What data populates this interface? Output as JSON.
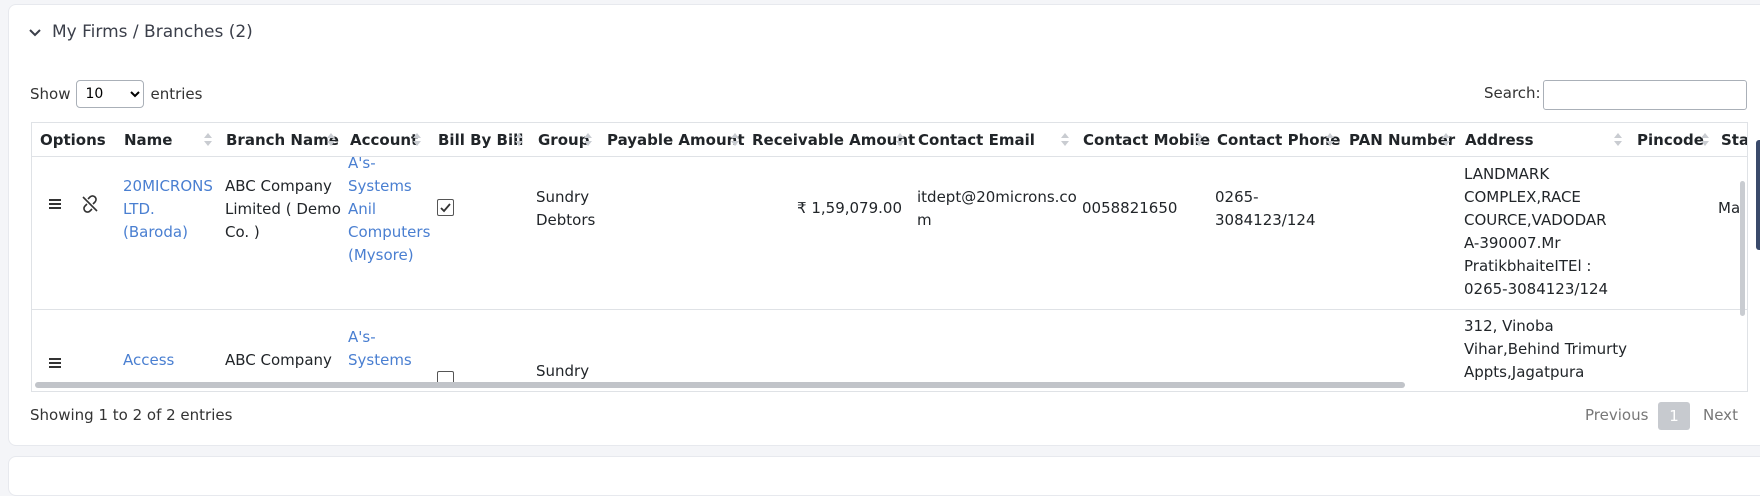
{
  "section": {
    "title": "My Firms / Branches (2)"
  },
  "length": {
    "show": "Show",
    "entries": "entries",
    "selected": "10",
    "options": [
      "10"
    ]
  },
  "search": {
    "label": "Search:",
    "value": ""
  },
  "columns": [
    "Options",
    "Name",
    "Branch Name",
    "Account",
    "Bill By Bill",
    "Group",
    "Payable Amount",
    "Receivable Amount",
    "Contact Email",
    "Contact Mobile",
    "Contact Phone",
    "PAN Number",
    "Address",
    "Pincode",
    "Stat"
  ],
  "rows": [
    {
      "name": [
        "20MICRONS",
        "LTD.",
        "(Baroda)"
      ],
      "branch": [
        "ABC Company",
        "Limited ( Demo",
        "Co. )"
      ],
      "account": [
        "A's-",
        "Systems",
        "Anil",
        "Computers",
        "(Mysore)"
      ],
      "bill_by_bill": true,
      "group": [
        "Sundry",
        "Debtors"
      ],
      "payable": "",
      "receivable": "₹ 1,59,079.00",
      "email": [
        "itdept@20microns.co",
        "m"
      ],
      "mobile": "0058821650",
      "phone": [
        "0265-",
        "3084123/124"
      ],
      "pan": "",
      "address": [
        "LANDMARK",
        "COMPLEX,RACE",
        "COURCE,VADODAR",
        "A-390007.Mr",
        "PratikbhaiteITEl :",
        "0265-3084123/124"
      ],
      "pincode": "",
      "state": "Ma"
    },
    {
      "name": [
        "Access"
      ],
      "branch": [
        "ABC Company"
      ],
      "account": [
        "A's-",
        "Systems"
      ],
      "bill_by_bill": false,
      "group": [
        "Sundry"
      ],
      "address": [
        "312, Vinoba",
        "Vihar,Behind Trimurty",
        "Appts,Jagatpura"
      ]
    }
  ],
  "info": "Showing 1 to 2 of 2 entries",
  "pagination": {
    "previous": "Previous",
    "current": "1",
    "next": "Next"
  }
}
